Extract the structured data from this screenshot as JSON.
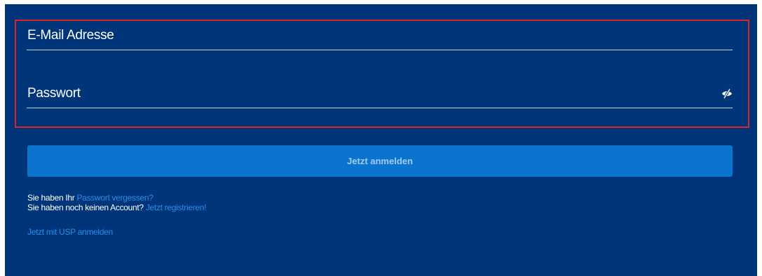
{
  "form": {
    "email": {
      "placeholder": "E-Mail Adresse",
      "value": ""
    },
    "password": {
      "placeholder": "Passwort",
      "value": "",
      "toggle_icon": "eye-slash-icon"
    },
    "submit_label": "Jetzt anmelden"
  },
  "help": {
    "forgot_prefix": "Sie haben Ihr",
    "forgot_link": "Passwort vergessen?",
    "register_prefix": "Sie haben noch keinen Account?",
    "register_link": "Jetzt registrieren!",
    "usp_link": "Jetzt mit USP anmelden"
  },
  "colors": {
    "panel_background": "#003679",
    "button_background": "#0b74cf",
    "link": "#2b8ae6",
    "highlight_border": "#d7262e"
  }
}
